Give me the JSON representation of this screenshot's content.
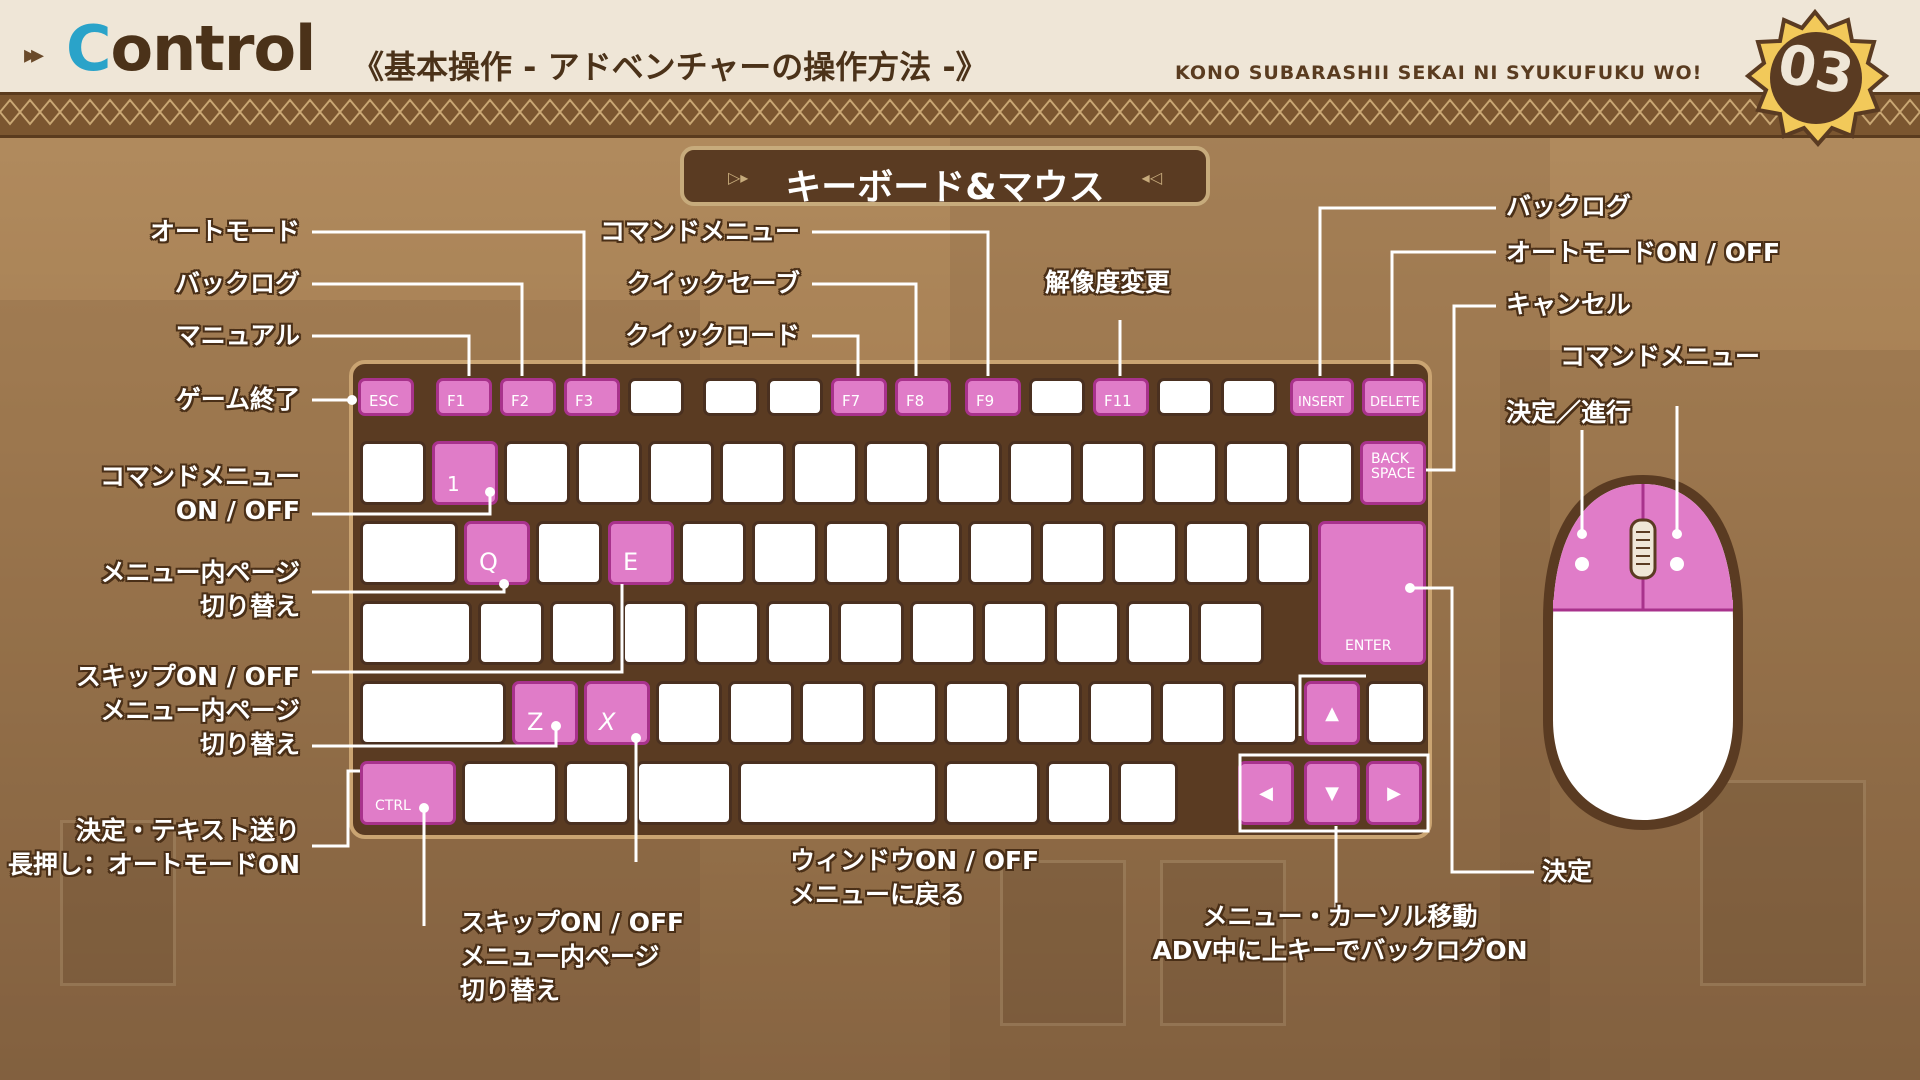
{
  "header": {
    "arrows": "▸▸",
    "title_c": "C",
    "title_rest": "ontrol",
    "subtitle": "《基本操作 - アドベンチャーの操作方法 -》",
    "series": "KONO SUBARASHII SEKAI NI SYUKUFUKU WO!",
    "page_number": "03"
  },
  "section": {
    "title": "キーボード&マウス",
    "left_deco": "▷▸",
    "right_deco": "◂◁"
  },
  "colors": {
    "accent": "#e07cc8",
    "frame": "#5a3b22",
    "header_bg": "#efe6d7",
    "logo_c": "#2aa3c9"
  },
  "labels": {
    "auto_mode": "オートモード",
    "backlog_left": "バックログ",
    "manual": "マニュアル",
    "game_exit": "ゲーム終了",
    "command_menu_top": "コマンドメニュー",
    "quick_save": "クイックセーブ",
    "quick_load": "クイックロード",
    "resolution": "解像度変更",
    "backlog_right": "バックログ",
    "auto_mode_onoff": "オートモードON / OFF",
    "cancel": "キャンセル",
    "command_menu_mouse": "コマンドメニュー",
    "confirm_advance": "決定／進行",
    "command_menu_onoff_1": "コマンドメニュー",
    "command_menu_onoff_2": "ON / OFF",
    "menu_page_switch_q_1": "メニュー内ページ",
    "menu_page_switch_q_2": "切り替え",
    "skip_z_1": "スキップON / OFF",
    "skip_z_2": "メニュー内ページ",
    "skip_z_3": "切り替え",
    "ctrl_1": "決定・テキスト送り",
    "ctrl_2": "長押し：オートモードON",
    "skip_ctrl_1": "スキップON / OFF",
    "skip_ctrl_2": "メニュー内ページ",
    "skip_ctrl_3": "切り替え",
    "window_x_1": "ウィンドウON / OFF",
    "window_x_2": "メニューに戻る",
    "cursor_1": "メニュー・カーソル移動",
    "cursor_2": "ADV中に上キーでバックログON",
    "enter_confirm": "決定"
  },
  "keys": {
    "esc": "ESC",
    "f1": "F1",
    "f2": "F2",
    "f3": "F3",
    "f7": "F7",
    "f8": "F8",
    "f9": "F9",
    "f11": "F11",
    "insert": "INSERT",
    "delete": "DELETE",
    "one": "1",
    "q": "Q",
    "e": "E",
    "z": "Z",
    "x": "X",
    "ctrl": "CTRL",
    "enter": "ENTER",
    "backspace_1": "BACK",
    "backspace_2": "SPACE",
    "up": "▲",
    "left": "◀",
    "down": "▼",
    "right": "▶"
  }
}
